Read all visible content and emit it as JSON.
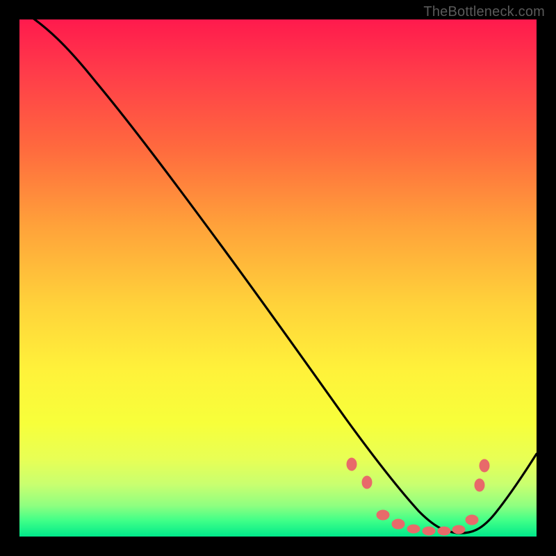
{
  "watermark": "TheBottleneck.com",
  "chart_data": {
    "type": "line",
    "title": "",
    "xlabel": "",
    "ylabel": "",
    "xlim": [
      0,
      100
    ],
    "ylim": [
      0,
      100
    ],
    "background_gradient_stops": [
      {
        "pos": 0,
        "color": "#ff1a4d"
      },
      {
        "pos": 10,
        "color": "#ff3b4a"
      },
      {
        "pos": 25,
        "color": "#ff6a3e"
      },
      {
        "pos": 40,
        "color": "#ffa23a"
      },
      {
        "pos": 55,
        "color": "#ffd23a"
      },
      {
        "pos": 68,
        "color": "#fff23a"
      },
      {
        "pos": 78,
        "color": "#f7ff3a"
      },
      {
        "pos": 85,
        "color": "#e8ff55"
      },
      {
        "pos": 90,
        "color": "#c8ff70"
      },
      {
        "pos": 94,
        "color": "#8fff80"
      },
      {
        "pos": 97,
        "color": "#3eff88"
      },
      {
        "pos": 100,
        "color": "#00e88a"
      }
    ],
    "series": [
      {
        "name": "bottleneck-curve",
        "color": "#000000",
        "x": [
          0,
          4,
          9,
          14,
          20,
          28,
          36,
          44,
          52,
          58,
          63,
          67,
          71,
          75,
          79,
          82,
          85,
          88,
          92,
          96,
          100
        ],
        "y": [
          102,
          100,
          94,
          88,
          80,
          70,
          59,
          48,
          37,
          28,
          21,
          15,
          10,
          6,
          3,
          2,
          2,
          2,
          5,
          10,
          16
        ]
      }
    ],
    "markers": {
      "name": "flat-range-dots",
      "color": "#e86a6a",
      "points": [
        {
          "x": 64,
          "y": 14
        },
        {
          "x": 67,
          "y": 10
        },
        {
          "x": 70,
          "y": 4
        },
        {
          "x": 73,
          "y": 2
        },
        {
          "x": 76,
          "y": 2
        },
        {
          "x": 79,
          "y": 2
        },
        {
          "x": 82,
          "y": 2
        },
        {
          "x": 85,
          "y": 2
        },
        {
          "x": 87,
          "y": 4
        },
        {
          "x": 89,
          "y": 10
        },
        {
          "x": 90,
          "y": 14
        }
      ]
    }
  }
}
